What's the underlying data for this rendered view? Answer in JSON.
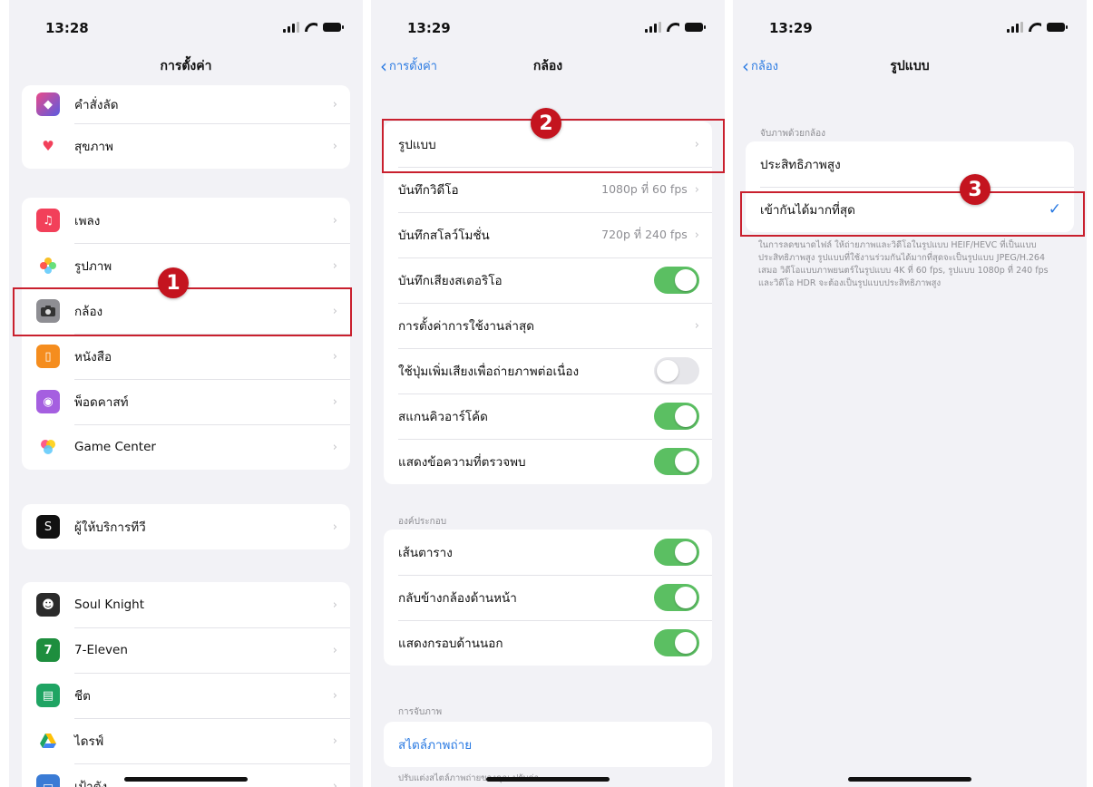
{
  "phone1": {
    "time": "13:28",
    "title": "การตั้งค่า",
    "group1": [
      {
        "label": "คำสั่งลัด",
        "icon": "shortcuts-icon",
        "color": "#5b5be0"
      },
      {
        "label": "สุขภาพ",
        "icon": "heart-icon",
        "color": "#ffffff"
      }
    ],
    "group2": [
      {
        "label": "เพลง",
        "icon": "music-note-icon",
        "color": "#f2405a"
      },
      {
        "label": "รูปภาพ",
        "icon": "photos-icon",
        "color": "#ffffff"
      },
      {
        "label": "กล้อง",
        "icon": "camera-icon",
        "color": "#8e8e93"
      },
      {
        "label": "หนังสือ",
        "icon": "book-icon",
        "color": "#f58d1e"
      },
      {
        "label": "พ็อดคาสท์",
        "icon": "podcast-icon",
        "color": "#a55fe0"
      },
      {
        "label": "Game Center",
        "icon": "game-center-icon",
        "color": "#ffffff"
      }
    ],
    "group3": [
      {
        "label": "ผู้ให้บริการทีวี",
        "icon": "tv-provider-icon",
        "color": "#111111"
      }
    ],
    "group4": [
      {
        "label": "Soul Knight",
        "icon": "soul-knight-icon",
        "color": "#2b2b2b"
      },
      {
        "label": "7-Eleven",
        "icon": "seven-eleven-icon",
        "color": "#1e8e3e"
      },
      {
        "label": "ชีต",
        "icon": "sheets-icon",
        "color": "#1fa463"
      },
      {
        "label": "ไดรฟ์",
        "icon": "drive-icon",
        "color": "#ffffff"
      },
      {
        "label": "เป้าตัง",
        "icon": "wallet-icon",
        "color": "#3a7bd5"
      }
    ],
    "badge": "1"
  },
  "phone2": {
    "time": "13:29",
    "back": "การตั้งค่า",
    "title": "กล้อง",
    "group1": [
      {
        "label": "รูปแบบ",
        "value": ""
      },
      {
        "label": "บันทึกวิดีโอ",
        "value": "1080p ที่ 60 fps"
      },
      {
        "label": "บันทึกสโลว์โมชั่น",
        "value": "720p ที่ 240 fps"
      },
      {
        "label": "บันทึกเสียงสเตอริโอ",
        "toggle": true
      },
      {
        "label": "การตั้งค่าการใช้งานล่าสุด",
        "value": ""
      },
      {
        "label": "ใช้ปุ่มเพิ่มเสียงเพื่อถ่ายภาพต่อเนื่อง",
        "toggle": false
      },
      {
        "label": "สแกนคิวอาร์โค้ด",
        "toggle": true
      },
      {
        "label": "แสดงข้อความที่ตรวจพบ",
        "toggle": true
      }
    ],
    "section2_header": "องค์ประกอบ",
    "group2": [
      {
        "label": "เส้นตาราง",
        "toggle": true
      },
      {
        "label": "กลับข้างกล้องด้านหน้า",
        "toggle": true
      },
      {
        "label": "แสดงกรอบด้านนอก",
        "toggle": true
      }
    ],
    "section3_header": "การจับภาพ",
    "group3": [
      {
        "label": "สไตล์ภาพถ่าย"
      }
    ],
    "footer": "ปรับแต่งสไตล์ภาพถ่ายของคุณ ปรับค่า",
    "badge": "2"
  },
  "phone3": {
    "time": "13:29",
    "back": "กล้อง",
    "title": "รูปแบบ",
    "section_header": "จับภาพด้วยกล้อง",
    "options": [
      {
        "label": "ประสิทธิภาพสูง",
        "selected": false
      },
      {
        "label": "เข้ากันได้มากที่สุด",
        "selected": true
      }
    ],
    "footer": "ในการลดขนาดไฟล์ ให้ถ่ายภาพและวิดีโอในรูปแบบ HEIF/HEVC ที่เป็นแบบประสิทธิภาพสูง รูปแบบที่ใช้งานร่วมกันได้มากที่สุดจะเป็นรูปแบบ JPEG/H.264 เสมอ วิดีโอแบบภาพยนตร์ในรูปแบบ 4K ที่ 60 fps, รูปแบบ 1080p ที่ 240 fps และวิดีโอ HDR จะต้องเป็นรูปแบบประสิทธิภาพสูง",
    "badge": "3"
  },
  "colors": {
    "highlight": "#c9202e",
    "toggle_on": "#5bbf62",
    "accent": "#2a7ae2"
  }
}
